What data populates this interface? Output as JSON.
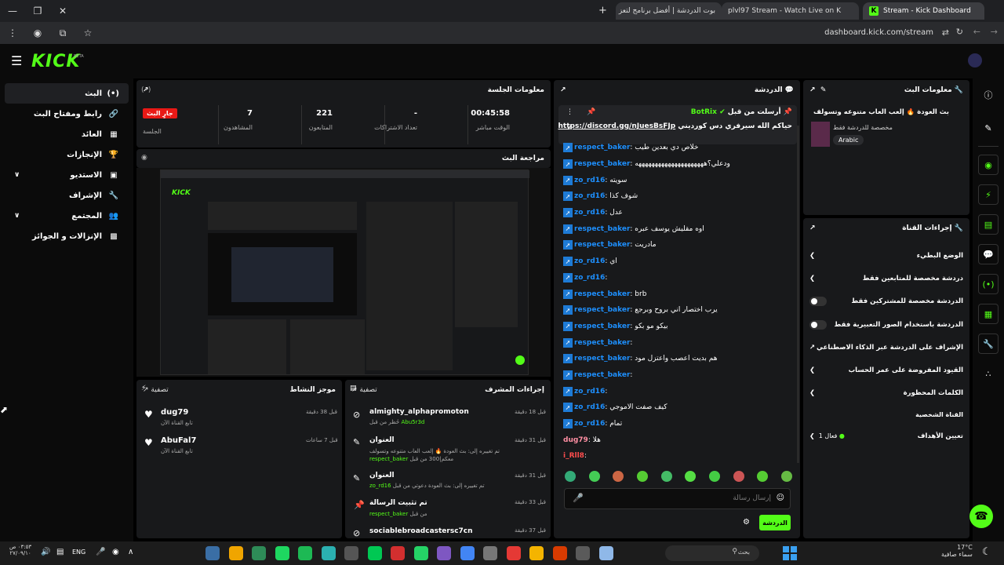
{
  "browser": {
    "tabs": [
      {
        "label": "Stream - Kick Dashboard"
      },
      {
        "label": "plvl97 Stream - Watch Live on K"
      },
      {
        "label": "بوت الدردشة | أفضل برنامج لتعز"
      }
    ],
    "url": "dashboard.kick.com/stream"
  },
  "brand": {
    "logo": "KICK",
    "beta": "BETA"
  },
  "sidebar": {
    "items": [
      {
        "label": "البث",
        "icon": "broadcast-icon"
      },
      {
        "label": "رابط ومفتاح البث",
        "icon": "link-icon"
      },
      {
        "label": "العائد",
        "icon": "revenue-icon"
      },
      {
        "label": "الإنجازات",
        "icon": "trophy-icon"
      },
      {
        "label": "الاستديو",
        "icon": "studio-icon"
      },
      {
        "label": "الإشراف",
        "icon": "wrench-icon"
      },
      {
        "label": "المجتمع",
        "icon": "community-icon"
      },
      {
        "label": "الإنزالات و الجوائز",
        "icon": "drops-icon"
      }
    ]
  },
  "session": {
    "title": "معلومات الجلسة",
    "live_badge": "جارٍ البث",
    "session_label": "الجلسة",
    "stats": [
      {
        "value": "00:45:58",
        "label": "الوقت مباشر"
      },
      {
        "value": "-",
        "label": "تعداد الاشتراكات"
      },
      {
        "value": "221",
        "label": "المتابعون"
      },
      {
        "value": "7",
        "label": "المشاهدون"
      }
    ]
  },
  "preview": {
    "title": "مراجعة البث"
  },
  "activity": {
    "title": "موجز النشاط",
    "filter": "تصفية",
    "items": [
      {
        "user": "dug79",
        "action": "تابع القناة الآن",
        "time": "قبل 38 دقيقة"
      },
      {
        "user": "AbuFal7",
        "action": "تابع القناة الآن",
        "time": "قبل 7 ساعات"
      }
    ]
  },
  "modactions": {
    "title": "إجراءات المشرف",
    "filter": "تصفية",
    "items": [
      {
        "title": "almighty_alphapromoton",
        "detail": "حُظر من قبل",
        "actor": "Abu5r3d",
        "time": "قبل 18 دقيقة"
      },
      {
        "title": "العنوان",
        "detail": "تم تغييره إلى: بث العودة 🔥 إلعب العاب متنوعه وتسولف معكم|300 من قبل",
        "actor": "respect_baker",
        "time": "قبل 31 دقيقة"
      },
      {
        "title": "العنوان",
        "detail": "تم تغييره إلى: بث العودة دعوتي من قبل",
        "actor": "zo_rd16",
        "time": "قبل 31 دقيقة"
      },
      {
        "title": "تم تثبيت الرسالة",
        "detail": "من قبل",
        "actor": "respect_baker",
        "time": "قبل 33 دقيقة"
      },
      {
        "title": "sociablebroadcastersc7cn",
        "detail": "",
        "actor": "",
        "time": "قبل 37 دقيقة"
      }
    ]
  },
  "chat": {
    "title": "الدردشة",
    "pinned": {
      "header": "أرسلت من قبل",
      "bot": "BotRix",
      "text": "حياكم الله سيرفري دس كورديني",
      "link": "https://discord.gg/nJuesBsFJp"
    },
    "messages": [
      {
        "user": "respect_baker",
        "text": "خلاص دي بعدين طيب",
        "color": "#1e90ff",
        "badge": true
      },
      {
        "user": "respect_baker",
        "text": "ودعلي؟هههههههههههههههههههههه",
        "color": "#1e90ff",
        "badge": true
      },
      {
        "user": "zo_rd16",
        "text": "سويته",
        "color": "#1e90ff",
        "badge": true
      },
      {
        "user": "zo_rd16",
        "text": "شوف كذا",
        "color": "#1e90ff",
        "badge": true
      },
      {
        "user": "zo_rd16",
        "text": "عدل",
        "color": "#1e90ff",
        "badge": true
      },
      {
        "user": "respect_baker",
        "text": "اوه مقليش يوسف عبره",
        "color": "#1e90ff",
        "badge": true
      },
      {
        "user": "respect_baker",
        "text": "مادريت",
        "color": "#1e90ff",
        "badge": true
      },
      {
        "user": "zo_rd16",
        "text": "اي",
        "color": "#1e90ff",
        "badge": true
      },
      {
        "user": "zo_rd16",
        "text": "",
        "color": "#1e90ff",
        "badge": true
      },
      {
        "user": "respect_baker",
        "text": "brb",
        "color": "#1e90ff",
        "badge": true
      },
      {
        "user": "respect_baker",
        "text": "يرب اختصار اني بروح وبرجع",
        "color": "#1e90ff",
        "badge": true
      },
      {
        "user": "respect_baker",
        "text": "بيكو مو بكو",
        "color": "#1e90ff",
        "badge": true
      },
      {
        "user": "respect_baker",
        "text": "",
        "color": "#1e90ff",
        "badge": true
      },
      {
        "user": "respect_baker",
        "text": "هم بديت اعصب واعتزل مود",
        "color": "#1e90ff",
        "badge": true
      },
      {
        "user": "respect_baker",
        "text": "",
        "color": "#1e90ff",
        "badge": true
      },
      {
        "user": "zo_rd16",
        "text": "",
        "color": "#1e90ff",
        "badge": true
      },
      {
        "user": "zo_rd16",
        "text": "كيف صفت الاموجي",
        "color": "#1e90ff",
        "badge": true
      },
      {
        "user": "zo_rd16",
        "text": "تمام",
        "color": "#1e90ff",
        "badge": true
      },
      {
        "user": "dug79",
        "text": "هلا",
        "color": "#ff8fa3",
        "badge": false
      },
      {
        "user": "i_Rll8",
        "text": "",
        "color": "#ff4d4d",
        "badge": false
      }
    ],
    "input_placeholder": "إرسال رسالة",
    "send_label": "الدردشة"
  },
  "stream_info": {
    "title": "معلومات البث",
    "stream_title": "بث العودة 🔥 إلعب العاب متنوعه وتسولف معكم|300",
    "category": "مخصصة للدردشة فقط",
    "tag": "Arabic"
  },
  "channel_actions": {
    "title": "إجراءات القناة",
    "items": [
      {
        "label": "الوضع البطيء",
        "control": "chevron"
      },
      {
        "label": "دردشة مخصصة للمتابعين فقط",
        "control": "chevron"
      },
      {
        "label": "الدردشة مخصصة للمشتركين فقط",
        "control": "toggle"
      },
      {
        "label": "الدردشة باستخدام الصور التعبيرية فقط",
        "control": "toggle"
      },
      {
        "label": "الإشراف على الدردشة عبر الذكاء الاصطناعي",
        "control": "external"
      },
      {
        "label": "القيود المفروضة على عمر الحساب",
        "control": "chevron"
      },
      {
        "label": "الكلمات المحظورة",
        "control": "chevron"
      }
    ],
    "personal_label": "القناة الشخصية",
    "goals_label": "تعيين الأهداف",
    "goals_status": "فعال 1"
  },
  "taskbar": {
    "weather_temp": "17°C",
    "weather_desc": "سماء صافية",
    "search_placeholder": "بحث",
    "lang": "ENG",
    "time": "٠٣:٥٣ ص",
    "date": "٢٧/٠٩/١٠"
  },
  "colors": {
    "accent": "#53fc18",
    "live": "#e91916",
    "panel": "#18191b",
    "chat_blue": "#1e90ff"
  }
}
